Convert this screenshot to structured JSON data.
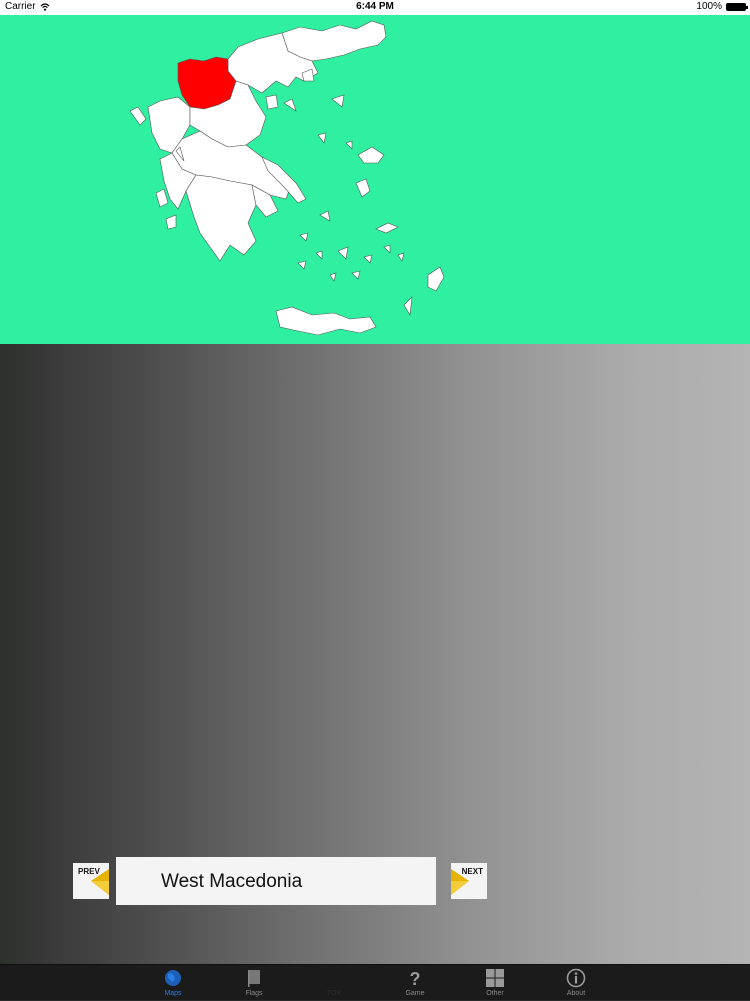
{
  "status_bar": {
    "carrier": "Carrier",
    "time": "6:44 PM",
    "battery": "100%"
  },
  "map": {
    "background": "#2ef0a0",
    "land_color": "#ffffff",
    "highlight_color": "#ff0000",
    "selected_region": "West Macedonia"
  },
  "navigator": {
    "prev_label": "PREV",
    "next_label": "NEXT",
    "region_name": "West Macedonia"
  },
  "tabs": [
    {
      "label": "Maps",
      "icon": "globe-icon",
      "active": true
    },
    {
      "label": "Flags",
      "icon": "flag-icon",
      "active": false
    },
    {
      "label": "TOK",
      "icon": "blank-icon",
      "active": false
    },
    {
      "label": "Game",
      "icon": "question-icon",
      "active": false
    },
    {
      "label": "Other",
      "icon": "grid-icon",
      "active": false
    },
    {
      "label": "About",
      "icon": "info-icon",
      "active": false
    }
  ]
}
